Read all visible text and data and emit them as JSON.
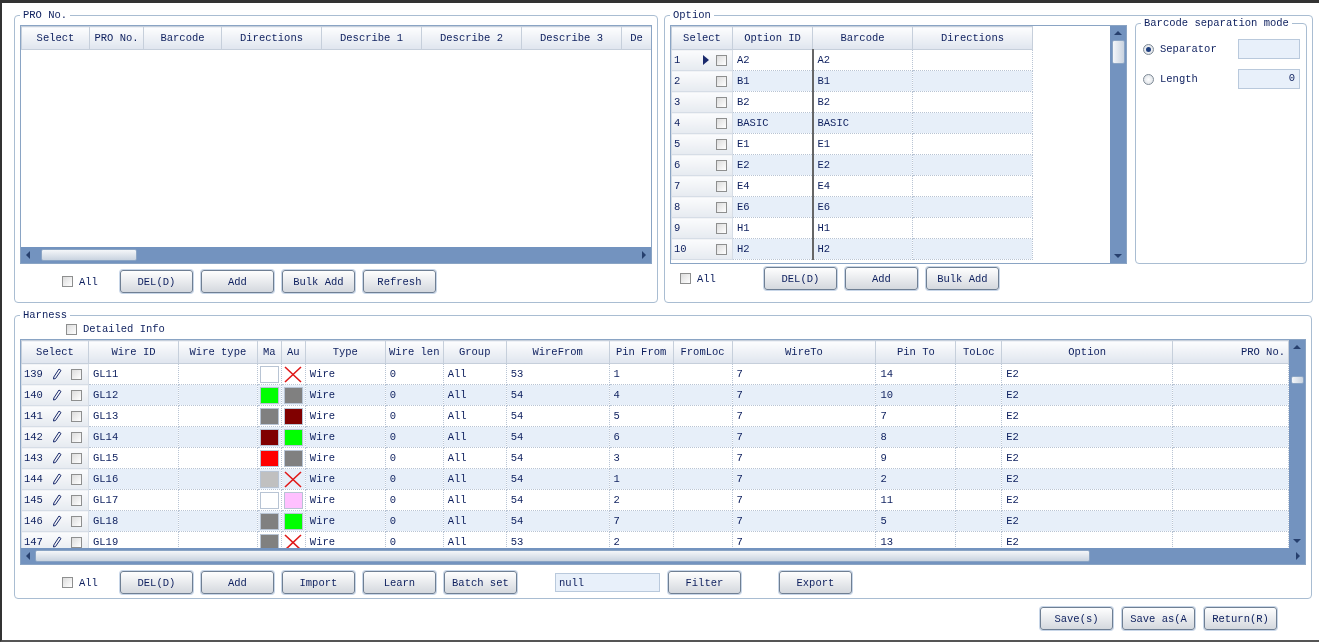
{
  "pro_group": {
    "title": "PRO No.",
    "columns": [
      "Select",
      "PRO No.",
      "Barcode",
      "Directions",
      "Describe 1",
      "Describe 2",
      "Describe 3",
      "De"
    ],
    "select_all": {
      "label": "All",
      "checked": false
    },
    "buttons": [
      "DEL(D)",
      "Add",
      "Bulk Add",
      "Refresh"
    ]
  },
  "option_group": {
    "title": "Option",
    "columns": [
      "Select",
      "Option ID",
      "Barcode",
      "Directions"
    ],
    "rows": [
      {
        "number": "1",
        "current": true,
        "checked": false,
        "option_id": "A2",
        "barcode": "A2"
      },
      {
        "number": "2",
        "current": false,
        "checked": false,
        "option_id": "B1",
        "barcode": "B1"
      },
      {
        "number": "3",
        "current": false,
        "checked": false,
        "option_id": "B2",
        "barcode": "B2"
      },
      {
        "number": "4",
        "current": false,
        "checked": false,
        "option_id": "BASIC",
        "barcode": "BASIC"
      },
      {
        "number": "5",
        "current": false,
        "checked": false,
        "option_id": "E1",
        "barcode": "E1"
      },
      {
        "number": "6",
        "current": false,
        "checked": false,
        "option_id": "E2",
        "barcode": "E2"
      },
      {
        "number": "7",
        "current": false,
        "checked": false,
        "option_id": "E4",
        "barcode": "E4"
      },
      {
        "number": "8",
        "current": false,
        "checked": false,
        "option_id": "E6",
        "barcode": "E6"
      },
      {
        "number": "9",
        "current": false,
        "checked": false,
        "option_id": "H1",
        "barcode": "H1"
      },
      {
        "number": "10",
        "current": false,
        "checked": false,
        "option_id": "H2",
        "barcode": "H2"
      }
    ],
    "select_all": {
      "label": "All",
      "checked": false
    },
    "buttons": [
      "DEL(D)",
      "Add",
      "Bulk Add"
    ]
  },
  "barcode_mode": {
    "title": "Barcode separation mode",
    "options": [
      {
        "label": "Separator",
        "selected": true
      },
      {
        "label": "Length",
        "selected": false,
        "value": "0"
      }
    ]
  },
  "harness": {
    "title": "Harness",
    "detailed_info": {
      "label": "Detailed Info",
      "checked": false
    },
    "columns": [
      "Select",
      "Wire ID",
      "Wire type",
      "Ma",
      "Au",
      "Type",
      "Wire len",
      "Group",
      "WireFrom",
      "Pin From",
      "FromLoc",
      "WireTo",
      "Pin To",
      "ToLoc",
      "Option",
      "PRO No."
    ],
    "rows": [
      {
        "number": "139",
        "checked": false,
        "wire_id": "GL11",
        "ma": {
          "kind": "swatch",
          "color": "#ffffff"
        },
        "au": {
          "kind": "none"
        },
        "type": "Wire",
        "wire_len": "0",
        "group": "All",
        "wire_from": "53",
        "pin_from": "1",
        "wire_to": "7",
        "pin_to": "14",
        "option": "E2"
      },
      {
        "number": "140",
        "checked": false,
        "wire_id": "GL12",
        "ma": {
          "kind": "swatch",
          "color": "#00ff00"
        },
        "au": {
          "kind": "swatch",
          "color": "#808080"
        },
        "type": "Wire",
        "wire_len": "0",
        "group": "All",
        "wire_from": "54",
        "pin_from": "4",
        "wire_to": "7",
        "pin_to": "10",
        "option": "E2"
      },
      {
        "number": "141",
        "checked": false,
        "wire_id": "GL13",
        "ma": {
          "kind": "swatch",
          "color": "#808080"
        },
        "au": {
          "kind": "swatch",
          "color": "#800000"
        },
        "type": "Wire",
        "wire_len": "0",
        "group": "All",
        "wire_from": "54",
        "pin_from": "5",
        "wire_to": "7",
        "pin_to": "7",
        "option": "E2"
      },
      {
        "number": "142",
        "checked": false,
        "wire_id": "GL14",
        "ma": {
          "kind": "swatch",
          "color": "#800000"
        },
        "au": {
          "kind": "swatch",
          "color": "#00ff00"
        },
        "type": "Wire",
        "wire_len": "0",
        "group": "All",
        "wire_from": "54",
        "pin_from": "6",
        "wire_to": "7",
        "pin_to": "8",
        "option": "E2"
      },
      {
        "number": "143",
        "checked": false,
        "wire_id": "GL15",
        "ma": {
          "kind": "swatch",
          "color": "#ff0000"
        },
        "au": {
          "kind": "swatch",
          "color": "#808080"
        },
        "type": "Wire",
        "wire_len": "0",
        "group": "All",
        "wire_from": "54",
        "pin_from": "3",
        "wire_to": "7",
        "pin_to": "9",
        "option": "E2"
      },
      {
        "number": "144",
        "checked": false,
        "wire_id": "GL16",
        "ma": {
          "kind": "swatch",
          "color": "#c0c0c0"
        },
        "au": {
          "kind": "none"
        },
        "type": "Wire",
        "wire_len": "0",
        "group": "All",
        "wire_from": "54",
        "pin_from": "1",
        "wire_to": "7",
        "pin_to": "2",
        "option": "E2"
      },
      {
        "number": "145",
        "checked": false,
        "wire_id": "GL17",
        "ma": {
          "kind": "swatch",
          "color": "#ffffff"
        },
        "au": {
          "kind": "swatch",
          "color": "#ffc0ff"
        },
        "type": "Wire",
        "wire_len": "0",
        "group": "All",
        "wire_from": "54",
        "pin_from": "2",
        "wire_to": "7",
        "pin_to": "11",
        "option": "E2"
      },
      {
        "number": "146",
        "checked": false,
        "wire_id": "GL18",
        "ma": {
          "kind": "swatch",
          "color": "#808080"
        },
        "au": {
          "kind": "swatch",
          "color": "#00ff00"
        },
        "type": "Wire",
        "wire_len": "0",
        "group": "All",
        "wire_from": "54",
        "pin_from": "7",
        "wire_to": "7",
        "pin_to": "5",
        "option": "E2"
      },
      {
        "number": "147",
        "checked": false,
        "wire_id": "GL19",
        "ma": {
          "kind": "swatch",
          "color": "#808080"
        },
        "au": {
          "kind": "none"
        },
        "type": "Wire",
        "wire_len": "0",
        "group": "All",
        "wire_from": "53",
        "pin_from": "2",
        "wire_to": "7",
        "pin_to": "13",
        "option": "E2"
      }
    ],
    "select_all": {
      "label": "All",
      "checked": false
    },
    "toolbar": [
      {
        "kind": "button",
        "label": "DEL(D)"
      },
      {
        "kind": "button",
        "label": "Add"
      },
      {
        "kind": "button",
        "label": "Import"
      },
      {
        "kind": "button",
        "label": "Learn"
      },
      {
        "kind": "button",
        "label": "Batch set"
      },
      {
        "kind": "field",
        "value": "null"
      },
      {
        "kind": "button",
        "label": "Filter"
      },
      {
        "kind": "button",
        "label": "Export"
      }
    ]
  },
  "footer_buttons": [
    "Save(s)",
    "Save as(A",
    "Return(R)"
  ]
}
